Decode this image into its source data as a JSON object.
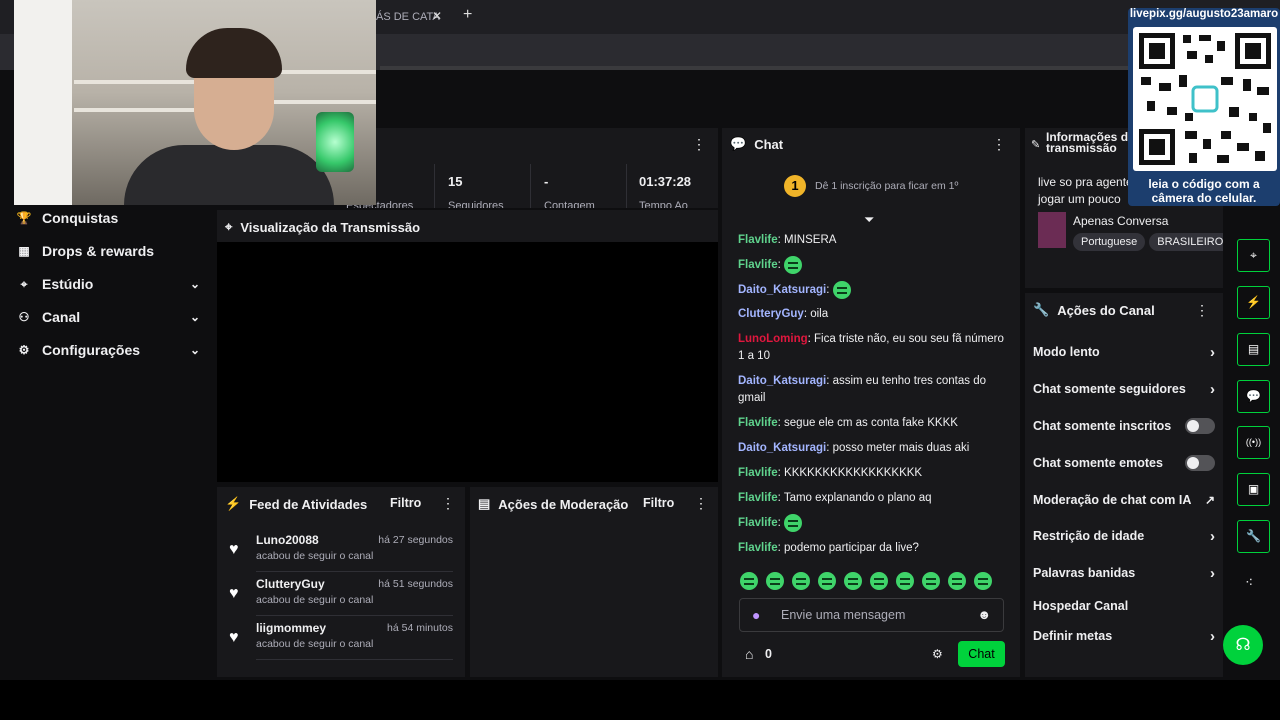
{
  "browser": {
    "tab_title": "ÁS DE CATA",
    "close_glyph": "✕",
    "new_tab_glyph": "+"
  },
  "sidebar": {
    "items": [
      {
        "label": "Conquistas",
        "icon": "trophy-icon",
        "glyph": "🏆",
        "chevron": ""
      },
      {
        "label": "Drops & rewards",
        "icon": "drops-icon",
        "glyph": "▦",
        "chevron": ""
      },
      {
        "label": "Estúdio",
        "icon": "studio-icon",
        "glyph": "⌖",
        "chevron": "⌄"
      },
      {
        "label": "Canal",
        "icon": "channel-icon",
        "glyph": "⚇",
        "chevron": "⌄"
      },
      {
        "label": "Configurações",
        "icon": "settings-icon",
        "glyph": "⚙",
        "chevron": "⌄"
      }
    ]
  },
  "stats": {
    "followers": "15",
    "viewers": "-",
    "time": "01:37:28",
    "labels": [
      "Espectadores",
      "Seguidores",
      "Contagem",
      "Tempo Ao"
    ]
  },
  "preview": {
    "title": "Visualização da Transmissão"
  },
  "feed": {
    "title": "Feed de Atividades",
    "filter_label": "Filtro",
    "items": [
      {
        "name": "Luno20088",
        "time": "há 27 segundos",
        "action": "acabou de seguir o canal"
      },
      {
        "name": "ClutteryGuy",
        "time": "há 51 segundos",
        "action": "acabou de seguir o canal"
      },
      {
        "name": "liigmommey",
        "time": "há 54 minutos",
        "action": "acabou de seguir o canal"
      }
    ]
  },
  "moderation": {
    "title": "Ações de Moderação",
    "filter_label": "Filtro"
  },
  "chat": {
    "title": "Chat",
    "badge": "1",
    "sub_goal": "Dê 1 inscrição para ficar em 1º",
    "messages": [
      {
        "user": "Flavlife",
        "color": "#5fd38d",
        "text": "MINSERA",
        "emote": false
      },
      {
        "user": "Flavlife",
        "color": "#5fd38d",
        "text": "",
        "emote": true
      },
      {
        "user": "Daito_Katsuragi",
        "color": "#a3b5ff",
        "text": "",
        "emote": true
      },
      {
        "user": "ClutteryGuy",
        "color": "#a3b5ff",
        "text": "oila",
        "emote": false
      },
      {
        "user": "LunoLoming",
        "color": "#e0173e",
        "text": "Fica triste não, eu sou seu fã número 1 a 10",
        "emote": false
      },
      {
        "user": "Daito_Katsuragi",
        "color": "#a3b5ff",
        "text": "assim eu tenho tres contas do gmail",
        "emote": false
      },
      {
        "user": "Flavlife",
        "color": "#5fd38d",
        "text": "segue ele cm as conta fake KKKK",
        "emote": false
      },
      {
        "user": "Daito_Katsuragi",
        "color": "#a3b5ff",
        "text": "posso meter mais duas aki",
        "emote": false
      },
      {
        "user": "Flavlife",
        "color": "#5fd38d",
        "text": "KKKKKKKKKKKKKKKKKK",
        "emote": false
      },
      {
        "user": "Flavlife",
        "color": "#5fd38d",
        "text": "Tamo explanando o plano aq",
        "emote": false
      },
      {
        "user": "Flavlife",
        "color": "#5fd38d",
        "text": "",
        "emote": true
      },
      {
        "user": "Flavlife",
        "color": "#5fd38d",
        "text": "podemo participar da live?",
        "emote": false
      }
    ],
    "input_placeholder": "Envie uma mensagem",
    "points": "0",
    "send_label": "Chat"
  },
  "info": {
    "title": "Informações da transmissão",
    "stream_title": "live so pra agente jogar um pouco",
    "category": "Apenas Conversa",
    "tags": [
      "Portuguese",
      "BRASILEIRO"
    ]
  },
  "channel_actions": {
    "title": "Ações do Canal",
    "items": [
      {
        "label": "Modo lento",
        "kind": "arrow",
        "mark": "›"
      },
      {
        "label": "Chat somente seguidores",
        "kind": "arrow",
        "mark": "›"
      },
      {
        "label": "Chat somente inscritos",
        "kind": "toggle",
        "mark": ""
      },
      {
        "label": "Chat somente emotes",
        "kind": "toggle",
        "mark": ""
      },
      {
        "label": "Moderação de chat com IA",
        "kind": "external",
        "mark": "↗"
      },
      {
        "label": "Restrição de idade",
        "kind": "arrow",
        "mark": "›"
      },
      {
        "label": "Palavras banidas",
        "kind": "arrow",
        "mark": "›"
      },
      {
        "label": "Hospedar Canal",
        "kind": "none",
        "mark": ""
      },
      {
        "label": "Definir metas",
        "kind": "arrow",
        "mark": "›"
      }
    ]
  },
  "rail": {
    "buttons": [
      {
        "icon": "preview-icon",
        "glyph": "⌖"
      },
      {
        "icon": "lightning-icon",
        "glyph": "⚡"
      },
      {
        "icon": "notes-icon",
        "glyph": "▤"
      },
      {
        "icon": "chat-bubble-icon",
        "glyph": "💬"
      },
      {
        "icon": "broadcast-icon",
        "glyph": "((•))"
      },
      {
        "icon": "video-icon",
        "glyph": "▣"
      },
      {
        "icon": "wrench-icon",
        "glyph": "🔧"
      }
    ],
    "extra_glyph": "⁖",
    "help_glyph": "☊"
  },
  "qr": {
    "url": "livepix.gg/augusto23amaro",
    "caption_line1": "leia o código com a",
    "caption_line2": "câmera do celular."
  },
  "colors": {
    "accent": "#00d23c",
    "panel": "#18181b",
    "background": "#0e0e10"
  }
}
